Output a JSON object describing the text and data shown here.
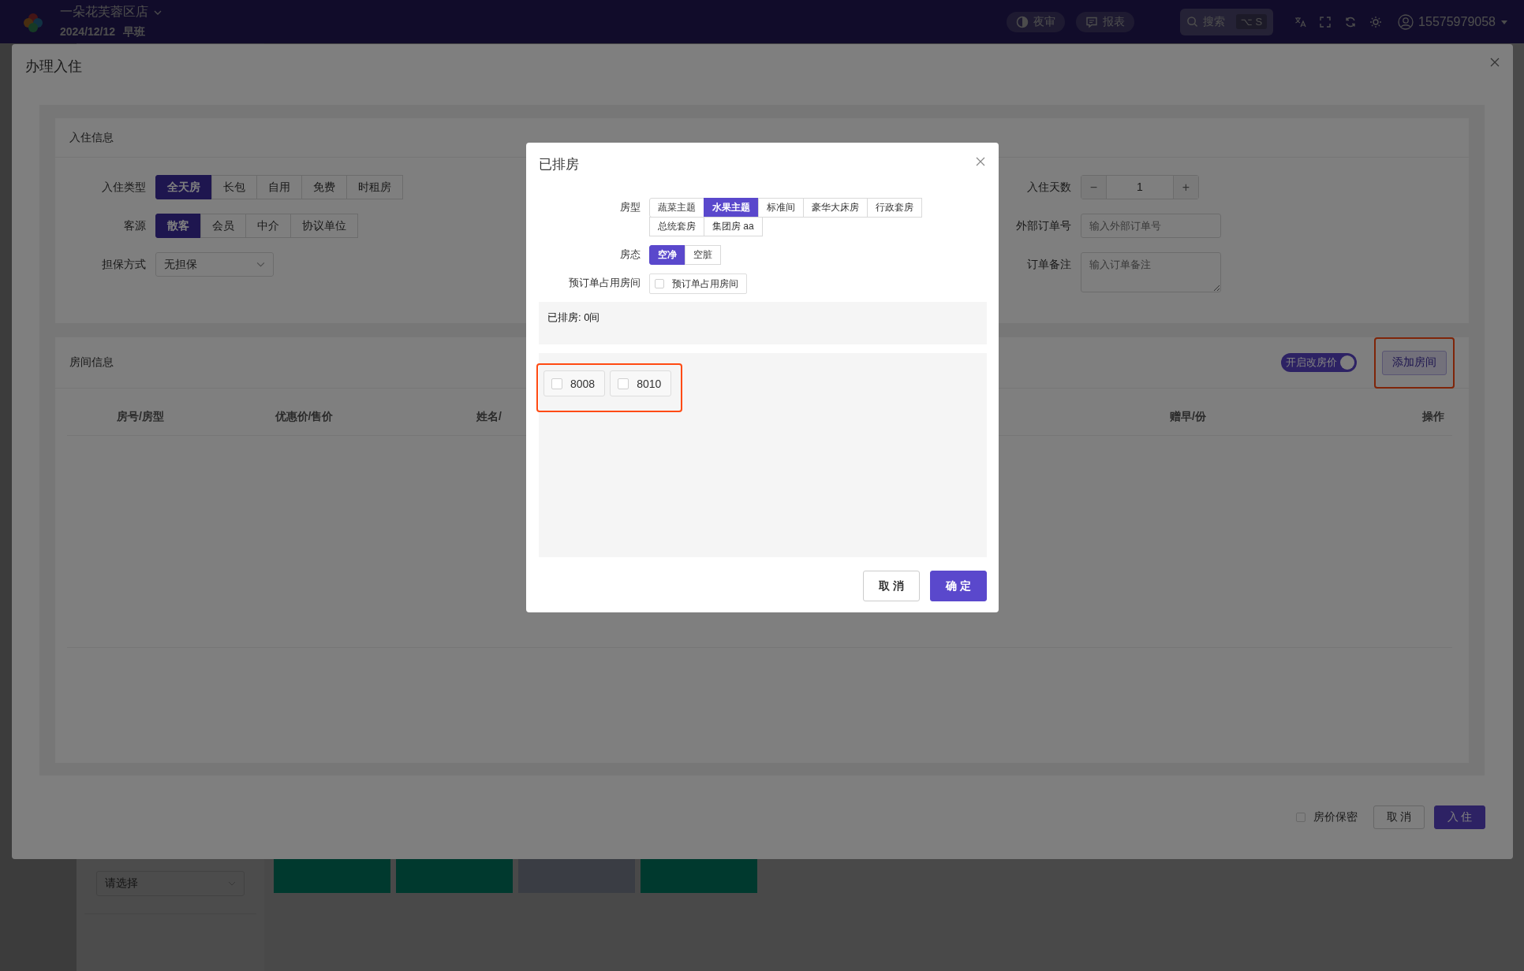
{
  "topbar": {
    "store_name": "一朵花芙蓉区店",
    "date": "2024/12/12",
    "shift": "早班",
    "buttons": [
      {
        "label": "夜审",
        "kind": "moon"
      },
      {
        "label": "报表",
        "kind": "chat"
      }
    ],
    "search": {
      "label": "搜索",
      "shortcut": "⌥ S"
    },
    "user": "15575979058"
  },
  "background": {
    "select_placeholder": "请选择"
  },
  "checkin_dialog": {
    "title": "办理入住",
    "checkin_info": {
      "title": "入住信息",
      "checkin_type": {
        "label": "入住类型",
        "options": [
          {
            "label": "全天房",
            "selected": true
          },
          {
            "label": "长包",
            "selected": false
          },
          {
            "label": "自用",
            "selected": false
          },
          {
            "label": "免费",
            "selected": false
          },
          {
            "label": "时租房",
            "selected": false
          }
        ]
      },
      "source": {
        "label": "客源",
        "options": [
          {
            "label": "散客",
            "selected": true
          },
          {
            "label": "会员",
            "selected": false
          },
          {
            "label": "中介",
            "selected": false
          },
          {
            "label": "协议单位",
            "selected": false
          }
        ]
      },
      "guarantee": {
        "label": "担保方式",
        "value": "无担保"
      },
      "days": {
        "label": "入住天数",
        "value": "1",
        "minus": "−",
        "plus": "+"
      },
      "external_order": {
        "label": "外部订单号",
        "placeholder": "输入外部订单号"
      },
      "remark": {
        "label": "订单备注",
        "placeholder": "输入订单备注"
      }
    },
    "room_info": {
      "title": "房间信息",
      "price_toggle": {
        "label": "开启改房价",
        "on": true
      },
      "add_button": {
        "label": "添加房间",
        "highlighted": true
      },
      "columns": [
        "房号/房型",
        "优惠价/售价",
        "姓名/",
        "赠早/份",
        "操作"
      ]
    },
    "footer": {
      "price_secret": {
        "label": "房价保密",
        "checked": false
      },
      "cancel": "取 消",
      "confirm": "入 住"
    }
  },
  "room_modal": {
    "title": "已排房",
    "room_type": {
      "label": "房型",
      "options": [
        {
          "label": "蔬菜主题",
          "selected": false
        },
        {
          "label": "水果主题",
          "selected": true
        },
        {
          "label": "标准间",
          "selected": false
        },
        {
          "label": "豪华大床房",
          "selected": false
        },
        {
          "label": "行政套房",
          "selected": false
        },
        {
          "label": "总统套房",
          "selected": false
        },
        {
          "label": "集团房 aa",
          "selected": false
        }
      ]
    },
    "room_status": {
      "label": "房态",
      "options": [
        {
          "label": "空净",
          "selected": true
        },
        {
          "label": "空脏",
          "selected": false
        }
      ]
    },
    "reserved": {
      "label": "预订单占用房间",
      "option": {
        "label": "预订单占用房间",
        "checked": false
      }
    },
    "summary": "已排房: 0间",
    "rooms": [
      {
        "number": "8008",
        "checked": false
      },
      {
        "number": "8010",
        "checked": false
      }
    ],
    "rooms_highlighted": true,
    "cancel": "取 消",
    "confirm": "确 定"
  }
}
